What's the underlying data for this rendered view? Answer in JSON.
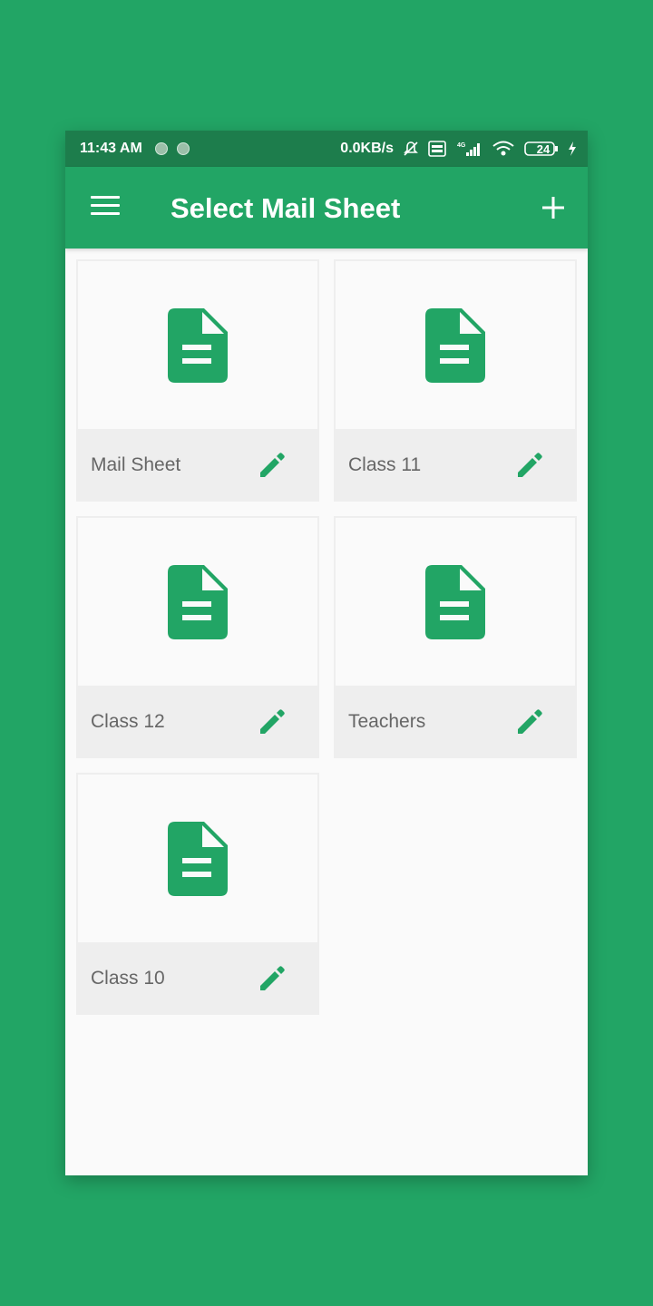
{
  "status_bar": {
    "time": "11:43 AM",
    "speed": "0.0KB/s",
    "battery": "24"
  },
  "app_bar": {
    "title": "Select Mail Sheet",
    "menu_icon": "hamburger-menu-icon",
    "add_icon": "plus-icon"
  },
  "colors": {
    "accent": "#22a565",
    "status_bar": "#1d7d4c",
    "card_footer": "#eeeeee",
    "label_text": "#666666"
  },
  "sheets": [
    {
      "label": "Mail Sheet",
      "icon": "document-icon",
      "action_icon": "pencil-edit-icon"
    },
    {
      "label": "Class 11",
      "icon": "document-icon",
      "action_icon": "pencil-edit-icon"
    },
    {
      "label": "Class 12",
      "icon": "document-icon",
      "action_icon": "pencil-edit-icon"
    },
    {
      "label": "Teachers",
      "icon": "document-icon",
      "action_icon": "pencil-edit-icon"
    },
    {
      "label": "Class 10",
      "icon": "document-icon",
      "action_icon": "pencil-edit-icon"
    }
  ]
}
